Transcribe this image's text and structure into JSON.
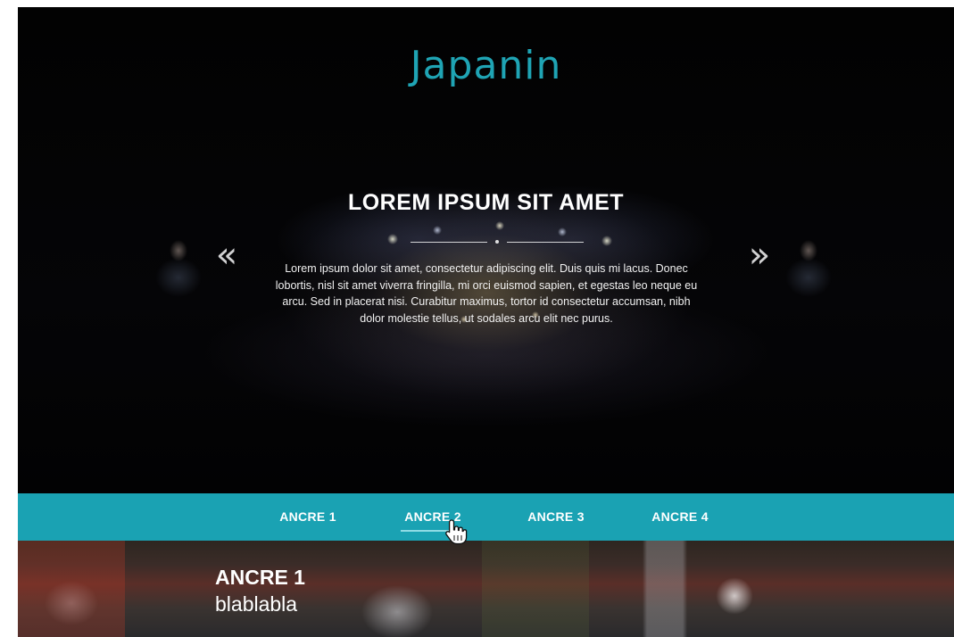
{
  "hero": {
    "logo": "Japanin",
    "title": "LOREM IPSUM SIT AMET",
    "text": "Lorem ipsum dolor sit amet, consectetur adipiscing elit. Duis quis mi lacus. Donec lobortis, nisl sit amet viverra fringilla, mi orci euismod sapien, et egestas leo neque eu arcu. Sed in placerat nisi. Curabitur maximus, tortor id consectetur accumsan, nibh dolor molestie tellus, ut sodales arcu elit nec purus.",
    "prev_icon": "«",
    "next_icon": "»"
  },
  "nav": {
    "items": [
      {
        "label": "ANCRE 1"
      },
      {
        "label": "ANCRE 2"
      },
      {
        "label": "ANCRE 3"
      },
      {
        "label": "ANCRE 4"
      }
    ],
    "active_index": 1
  },
  "section": {
    "title": "ANCRE 1",
    "subtitle": "blablabla"
  },
  "colors": {
    "accent": "#1aa2b3",
    "logo": "#1fa4b4",
    "hero_background": "#020202"
  },
  "icons": {
    "prev": "chevrons-left-icon",
    "next": "chevrons-right-icon",
    "cursor": "hand-pointer-icon"
  }
}
